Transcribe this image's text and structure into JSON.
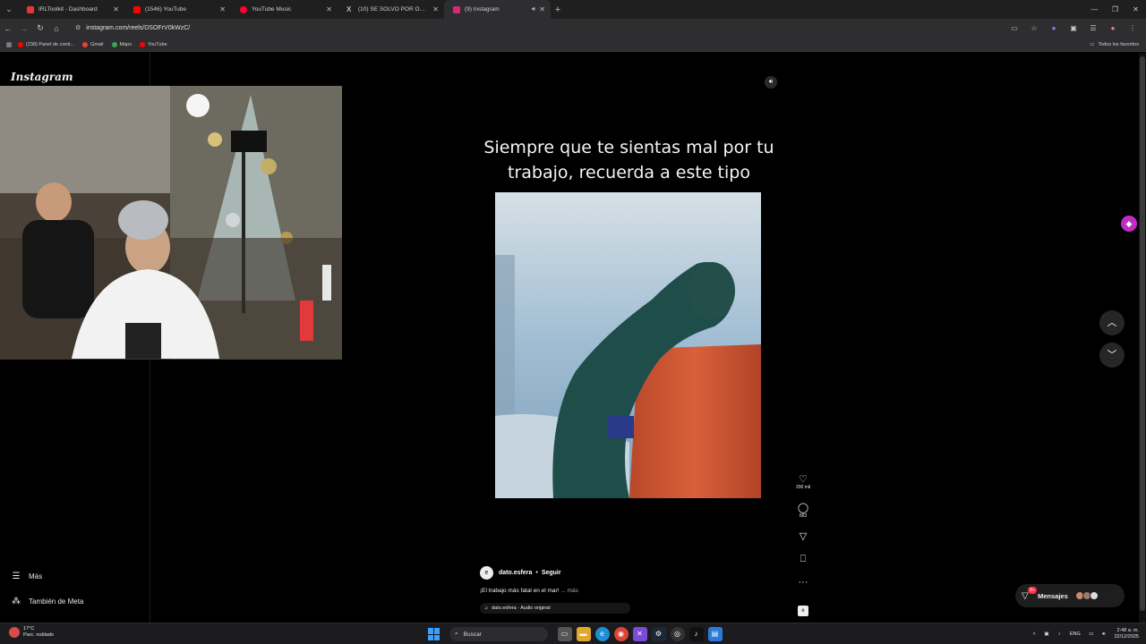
{
  "browser": {
    "tabs": [
      {
        "title": "IRLToolkit - Dashboard",
        "favicon_color": "#e53935",
        "active": false,
        "sound": false
      },
      {
        "title": "(1546) YouTube",
        "favicon_color": "#ff0000",
        "active": false,
        "sound": false
      },
      {
        "title": "YouTube Music",
        "favicon_color": "#ff0033",
        "active": false,
        "sound": false
      },
      {
        "title": "(10) SE SOLVO POR ORINAR - X",
        "favicon_color": "#ffffff",
        "active": false,
        "sound": false
      },
      {
        "title": "(9) Instagram",
        "favicon_color": "#d62976",
        "active": true,
        "sound": true
      }
    ],
    "new_tab_icon": "+",
    "url": "instagram.com/reels/DSOFrV0kWzC/",
    "bookmarks": [
      {
        "label": "(238) Panel de contr...",
        "color": "#ff0000"
      },
      {
        "label": "Gmail",
        "color": "#ea4335"
      },
      {
        "label": "Maps",
        "color": "#34a853"
      },
      {
        "label": "YouTube",
        "color": "#ff0000"
      }
    ],
    "bookmarks_right": "Todos los favoritos"
  },
  "instagram": {
    "logo": "Instagram",
    "sidebar": {
      "more_label": "Más",
      "meta_label": "También de Meta"
    },
    "reel": {
      "overlay_text": "Siempre que te sientas mal por tu trabajo, recuerda a este tipo",
      "author_initial": "e",
      "author": "dato.esfera",
      "separator": "•",
      "follow_label": "Seguir",
      "description": "¡El trabajo más fatal en el mar!",
      "more_label": "... más",
      "audio_label": "dato.esfera · Audio original"
    },
    "actions": {
      "likes": "200 mil",
      "comments": "663"
    },
    "messages": {
      "label": "Mensajes",
      "badge": "9+"
    }
  },
  "taskbar": {
    "temperature": "17°C",
    "weather_text": "Parc. nublado",
    "search_placeholder": "Buscar",
    "language": "ENG",
    "time": "2:48 a. m.",
    "date": "22/12/2025"
  },
  "colors": {
    "accent_instagram": "#c02cc3",
    "chrome_bg": "#1f1f1f",
    "toolbar_bg": "#2e2e30"
  }
}
